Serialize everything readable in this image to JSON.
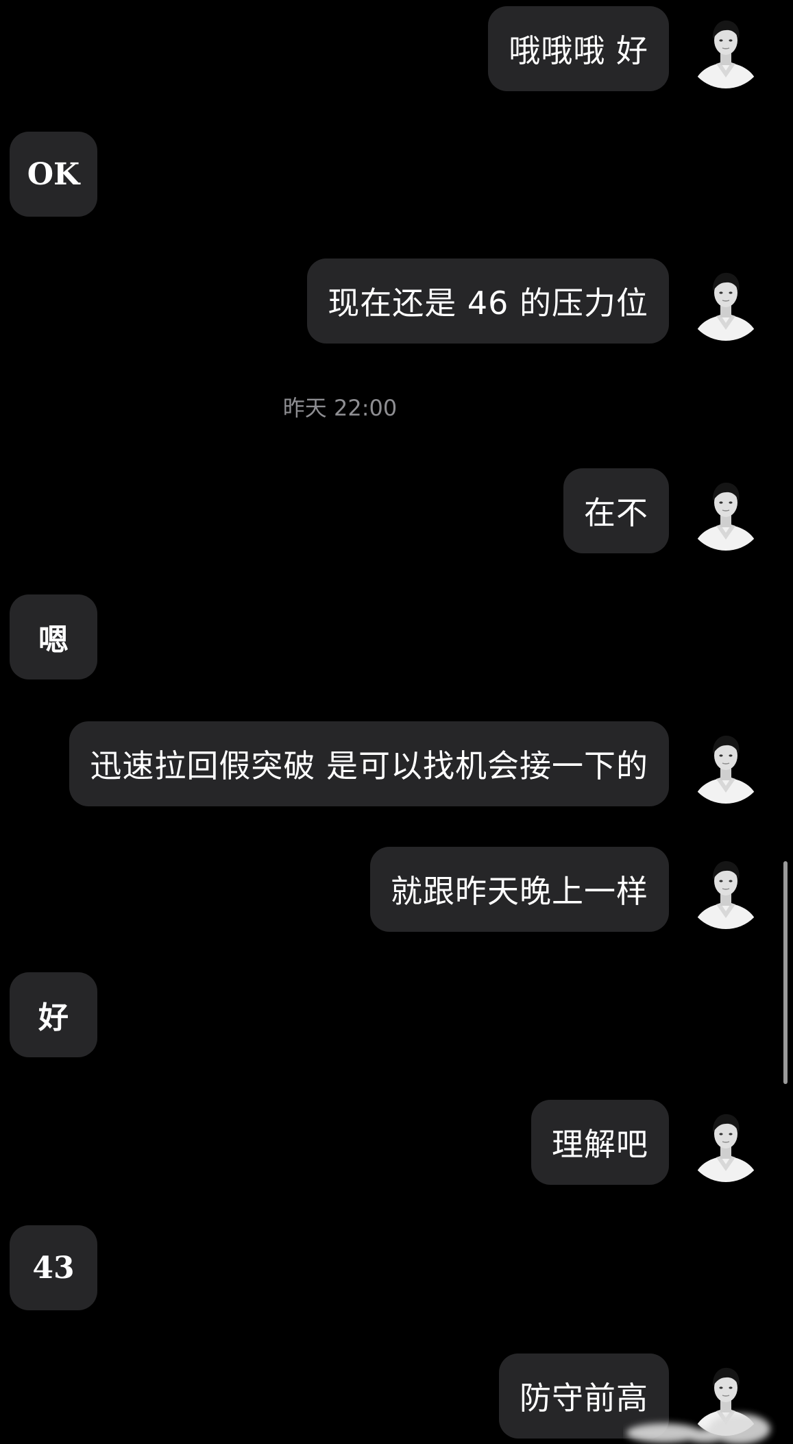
{
  "chat": {
    "timestamp": "昨天 22:00",
    "messages": [
      {
        "side": "sent",
        "text": "哦哦哦 好"
      },
      {
        "side": "received",
        "text": "OK"
      },
      {
        "side": "sent",
        "text": "现在还是 46 的压力位"
      },
      {
        "side": "sent",
        "text": "在不"
      },
      {
        "side": "received",
        "text": "嗯"
      },
      {
        "side": "sent",
        "text": "迅速拉回假突破 是可以找机会接一下的"
      },
      {
        "side": "sent",
        "text": "就跟昨天晚上一样"
      },
      {
        "side": "received",
        "text": "好"
      },
      {
        "side": "sent",
        "text": "理解吧"
      },
      {
        "side": "received",
        "text": "43"
      },
      {
        "side": "sent",
        "text": "防守前高"
      }
    ]
  },
  "avatar": {
    "icon": "user-avatar-photo"
  },
  "colors": {
    "background": "#000000",
    "bubble": "#262628",
    "text": "#ffffff",
    "timestamp": "#8e8e92"
  }
}
